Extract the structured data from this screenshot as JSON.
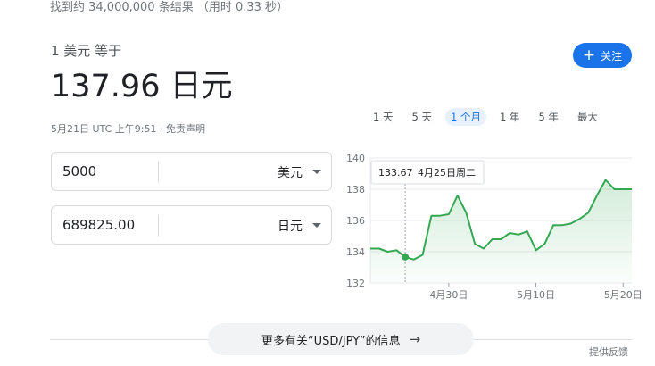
{
  "stats_text": "找到约 34,000,000 条结果 （用时 0.33 秒）",
  "conversion": {
    "label": "1 美元 等于",
    "result": "137.96 日元",
    "date_line": "5月21日 UTC 上午9:51 · 免责声明"
  },
  "follow_button": {
    "icon": "plus-icon",
    "label": "关注",
    "color": "#1a73e8"
  },
  "ranges": [
    "1 天",
    "5 天",
    "1 个月",
    "1 年",
    "5 年",
    "最大"
  ],
  "active_range": "1 个月",
  "converter": {
    "from": {
      "value": "5000",
      "currency": "美元"
    },
    "to": {
      "value": "689825.00",
      "currency": "日元"
    }
  },
  "tooltip": {
    "value": "133.67",
    "date": "4月25日周二"
  },
  "more_button": {
    "label": "更多有关“USD/JPY”的信息",
    "icon": "arrow-right-icon"
  },
  "feedback": "提供反馈",
  "chart_data": {
    "type": "area",
    "color": "#34a853",
    "x": [
      "4月21日",
      "4月22日",
      "4月23日",
      "4月24日",
      "4月25日",
      "4月26日",
      "4月27日",
      "4月28日",
      "4月29日",
      "4月30日",
      "5月1日",
      "5月2日",
      "5月3日",
      "5月4日",
      "5月5日",
      "5月6日",
      "5月7日",
      "5月8日",
      "5月9日",
      "5月10日",
      "5月11日",
      "5月12日",
      "5月13日",
      "5月14日",
      "5月15日",
      "5月16日",
      "5月17日",
      "5月18日",
      "5月19日",
      "5月20日",
      "5月21日"
    ],
    "values": [
      134.2,
      134.2,
      134.0,
      134.1,
      133.67,
      133.5,
      133.8,
      136.3,
      136.3,
      136.4,
      137.6,
      136.5,
      134.5,
      134.2,
      134.8,
      134.8,
      135.2,
      135.1,
      135.3,
      134.1,
      134.5,
      135.7,
      135.7,
      135.8,
      136.1,
      136.5,
      137.6,
      138.6,
      138.0,
      138.0,
      138.0
    ],
    "ylim": [
      132,
      140
    ],
    "yticks": [
      "132",
      "134",
      "136",
      "138",
      "140"
    ],
    "xticks": [
      {
        "label": "4月30日",
        "index": 9
      },
      {
        "label": "5月10日",
        "index": 19
      },
      {
        "label": "5月20日",
        "index": 29
      }
    ],
    "highlight_index": 4
  }
}
